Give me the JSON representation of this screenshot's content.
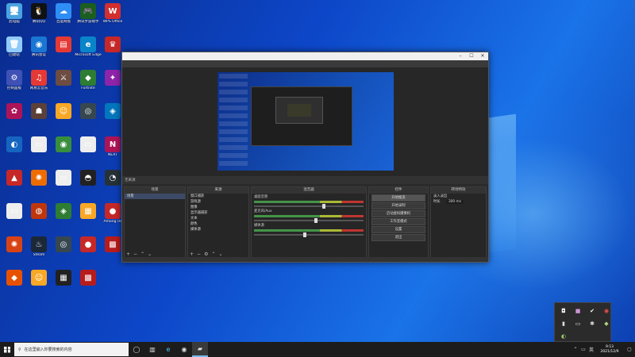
{
  "desktop": {
    "icons": [
      {
        "label": "此电脑",
        "color": "#4aa3df",
        "glyph": "🖥"
      },
      {
        "label": "腾讯QQ",
        "color": "#111111",
        "glyph": "🐧"
      },
      {
        "label": "百度网盘",
        "color": "#2f8ef5",
        "glyph": "☁"
      },
      {
        "label": "腾讯手游助手",
        "color": "#1b5e20",
        "glyph": "🎮"
      },
      {
        "label": "WPS Office",
        "color": "#d32f2f",
        "glyph": "W"
      },
      {
        "label": "回收站",
        "color": "#90caf9",
        "glyph": "🗑"
      },
      {
        "label": "腾讯会议",
        "color": "#1976d2",
        "glyph": "◉"
      },
      {
        "label": "",
        "color": "#e53935",
        "glyph": "▤"
      },
      {
        "label": "Microsoft Edge",
        "color": "#0a84c9",
        "glyph": "e"
      },
      {
        "label": "",
        "color": "#c62828",
        "glyph": "♛"
      },
      {
        "label": "控制面板",
        "color": "#3f51b5",
        "glyph": "⚙"
      },
      {
        "label": "网易云音乐",
        "color": "#e53935",
        "glyph": "♫"
      },
      {
        "label": "",
        "color": "#6d4c41",
        "glyph": "⚔"
      },
      {
        "label": "Fortnite",
        "color": "#2e7d32",
        "glyph": "◆"
      },
      {
        "label": "",
        "color": "#8e24aa",
        "glyph": "✦"
      },
      {
        "label": "",
        "color": "#ad1457",
        "glyph": "✿"
      },
      {
        "label": "",
        "color": "#5d4037",
        "glyph": "☗"
      },
      {
        "label": "",
        "color": "#f9a825",
        "glyph": "☺"
      },
      {
        "label": "",
        "color": "#37474f",
        "glyph": "◎"
      },
      {
        "label": "",
        "color": "#0277bd",
        "glyph": "◈"
      },
      {
        "label": "",
        "color": "#1565c0",
        "glyph": "◐"
      },
      {
        "label": "",
        "color": "#eeeeee",
        "glyph": "▭"
      },
      {
        "label": "",
        "color": "#388e3c",
        "glyph": "◉"
      },
      {
        "label": "",
        "color": "#eeeeee",
        "glyph": "▭"
      },
      {
        "label": "NEXT",
        "color": "#ad1457",
        "glyph": "N"
      },
      {
        "label": "",
        "color": "#c62828",
        "glyph": "▲"
      },
      {
        "label": "",
        "color": "#ef6c00",
        "glyph": "✺"
      },
      {
        "label": "",
        "color": "#eeeeee",
        "glyph": "▭"
      },
      {
        "label": "",
        "color": "#212121",
        "glyph": "◓"
      },
      {
        "label": "",
        "color": "#263238",
        "glyph": "◔"
      },
      {
        "label": "",
        "color": "#eeeeee",
        "glyph": "▭"
      },
      {
        "label": "",
        "color": "#bf360c",
        "glyph": "◍"
      },
      {
        "label": "",
        "color": "#2e7d32",
        "glyph": "◈"
      },
      {
        "label": "",
        "color": "#f9a825",
        "glyph": "▦"
      },
      {
        "label": "Among Us",
        "color": "#c62828",
        "glyph": "●"
      },
      {
        "label": "",
        "color": "#d84315",
        "glyph": "✺"
      },
      {
        "label": "Steam",
        "color": "#1b2838",
        "glyph": "♨"
      },
      {
        "label": "",
        "color": "#37474f",
        "glyph": "◎"
      },
      {
        "label": "",
        "color": "#c62828",
        "glyph": "●"
      },
      {
        "label": "",
        "color": "#b71c1c",
        "glyph": "▩"
      },
      {
        "label": "",
        "color": "#e65100",
        "glyph": "◆"
      },
      {
        "label": "",
        "color": "#f9a825",
        "glyph": "☺"
      },
      {
        "label": "",
        "color": "#212121",
        "glyph": "▦"
      },
      {
        "label": "",
        "color": "#b71c1c",
        "glyph": "▩"
      }
    ]
  },
  "obs": {
    "docks_header": "无来源",
    "scenes": {
      "title": "场景",
      "items": [
        "场景",
        "场景 2"
      ]
    },
    "sources": {
      "title": "来源",
      "items": [
        "窗口捕获",
        "游戏源",
        "图像",
        "显示器捕获",
        "文本",
        "颜色",
        "媒体源"
      ]
    },
    "mixer": {
      "title": "混音器",
      "tracks": [
        {
          "name": "桌面音频",
          "level": 0.62
        },
        {
          "name": "麦克风/Aux",
          "level": 0.55
        },
        {
          "name": "媒体源",
          "level": 0.45
        }
      ]
    },
    "controls": {
      "title": "控件",
      "buttons": [
        "开始推流",
        "开始录制",
        "启动虚拟摄像机",
        "工作室模式",
        "设置",
        "退出"
      ]
    },
    "transitions": {
      "title": "转场特效",
      "label1": "淡入淡出",
      "label2": "时长",
      "value": "300 ms"
    }
  },
  "taskbar": {
    "search_placeholder": "在这里输入你要搜索的内容",
    "time": "9:13",
    "date": "2021/12/9"
  }
}
